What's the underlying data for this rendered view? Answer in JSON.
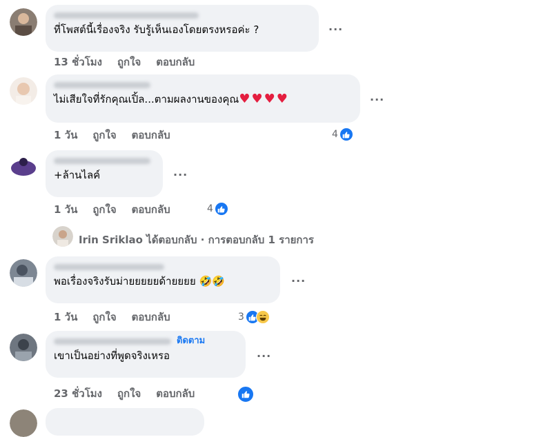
{
  "comments": [
    {
      "text": "ที่โพสต์นี้เรื่องจริง รับรู้เห็นเองโดยตรงหรอค่ะ ?",
      "time": "13 ชั่วโมง",
      "like": "ถูกใจ",
      "reply": "ตอบกลับ"
    },
    {
      "text": "ไม่เสียใจที่รักคุณเปิ้ล...ตามผลงานของคุณ",
      "hearts": "♥♥♥♥",
      "time": "1 วัน",
      "like": "ถูกใจ",
      "reply": "ตอบกลับ",
      "reactions": "4"
    },
    {
      "text": "+ล้านไลค์",
      "time": "1 วัน",
      "like": "ถูกใจ",
      "reply": "ตอบกลับ",
      "reactions": "4"
    },
    {
      "text": "พอเรื่องจริงรับม่ายยยยยด้ายยยย",
      "emoji": "🤣🤣",
      "time": "1 วัน",
      "like": "ถูกใจ",
      "reply": "ตอบกลับ",
      "reactions": "3"
    },
    {
      "text": "เขาเป็นอย่างที่พูดจริงเหรอ",
      "follow": "ติดตาม",
      "time": "23 ชั่วโมง",
      "like": "ถูกใจ",
      "reply": "ตอบกลับ"
    }
  ],
  "reply_summary": {
    "name": "Irin Sriklao",
    "text": "ได้ตอบกลับ · การตอบกลับ 1 รายการ"
  },
  "more_icon": "···",
  "colors": {
    "bubble": "#f0f2f5",
    "like": "#1877f2",
    "secondary": "#65676b"
  }
}
